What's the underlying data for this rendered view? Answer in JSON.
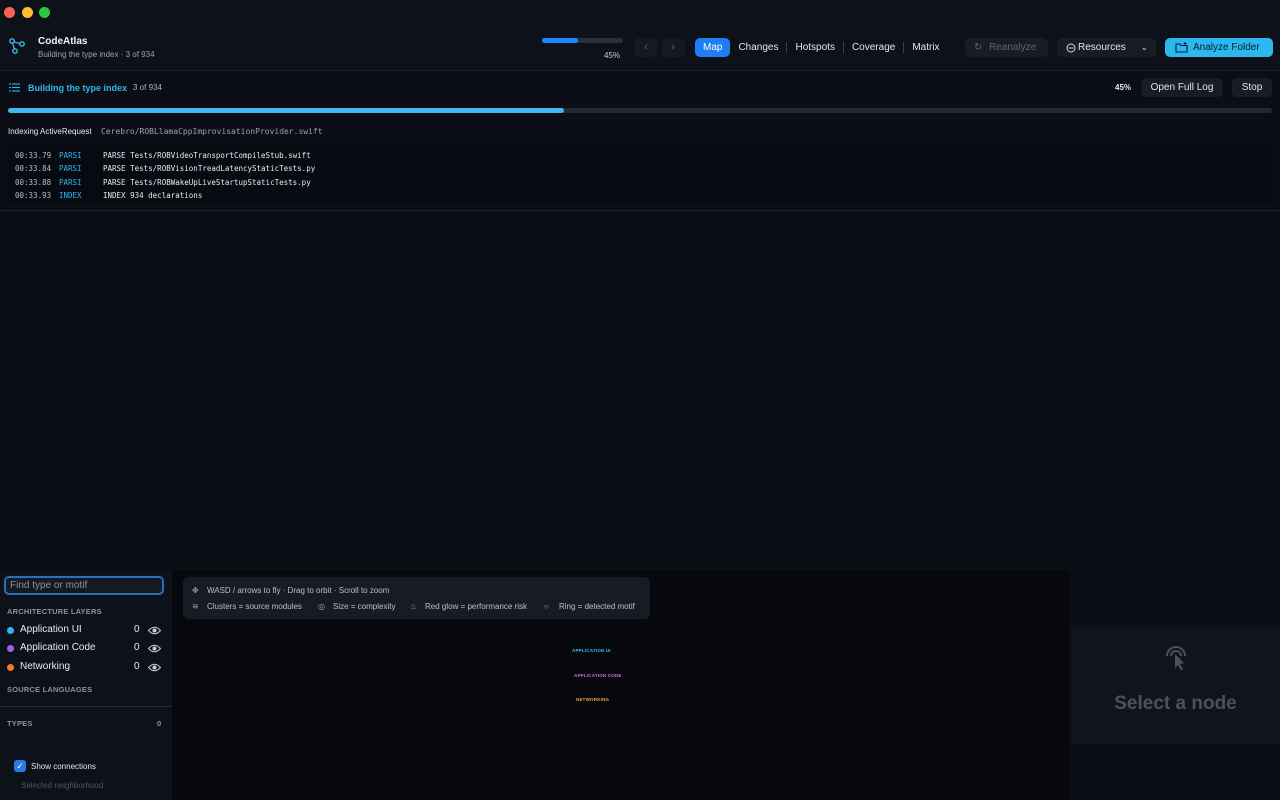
{
  "window": {
    "controls": {
      "close_color": "#ff5f57",
      "minimize_color": "#febc2e",
      "zoom_color": "#28c840"
    }
  },
  "header": {
    "app_title": "CodeAtlas",
    "subtitle": "Building the type index · 3 of 934",
    "progress": {
      "percent_label": "45%",
      "fraction": 0.45
    },
    "tabs": [
      {
        "label": "Map",
        "active": true
      },
      {
        "label": "Changes",
        "active": false
      },
      {
        "label": "Hotspots",
        "active": false
      },
      {
        "label": "Coverage",
        "active": false
      },
      {
        "label": "Matrix",
        "active": false
      }
    ],
    "reanalyze_label": "Reanalyze",
    "resources_label": "Resources",
    "analyze_label": "Analyze Folder",
    "accent_color": "#2cb7ee"
  },
  "status": {
    "title": "Building the type index",
    "count": "3 of 934",
    "percent_label": "45%",
    "fraction": 0.44,
    "open_log_label": "Open Full Log",
    "stop_label": "Stop",
    "indexing_label": "Indexing ActiveRequest",
    "indexing_path": "Cerebro/ROBLlamaCppImprovisationProvider.swift"
  },
  "log": [
    {
      "time": "00:33.79",
      "kind": "PARSI",
      "message": "PARSE Tests/ROBVideoTransportCompileStub.swift"
    },
    {
      "time": "00:33.84",
      "kind": "PARSI",
      "message": "PARSE Tests/ROBVisionTreadLatencyStaticTests.py"
    },
    {
      "time": "00:33.88",
      "kind": "PARSI",
      "message": "PARSE Tests/ROBWakeUpLiveStartupStaticTests.py"
    },
    {
      "time": "00:33.93",
      "kind": "INDEX",
      "message": "INDEX 934 declarations"
    }
  ],
  "sidebar": {
    "search_placeholder": "Find type or motif",
    "architecture_title": "ARCHITECTURE LAYERS",
    "layers": [
      {
        "name": "Application UI",
        "count": "0",
        "color": "#2fb6ef"
      },
      {
        "name": "Application Code",
        "count": "0",
        "color": "#a45ee8"
      },
      {
        "name": "Networking",
        "count": "0",
        "color": "#ef7d2f"
      }
    ],
    "source_languages_title": "SOURCE LANGUAGES",
    "types_title": "TYPES",
    "types_count": "0",
    "show_connections_label": "Show connections",
    "selected_neighborhood_label": "Selected neighborhood"
  },
  "canvas": {
    "hint_nav": "WASD / arrows to fly · Drag to orbit · Scroll to zoom",
    "hint_clusters": "Clusters = source modules",
    "hint_size": "Size = complexity",
    "hint_glow": "Red glow = performance risk",
    "hint_ring": "Ring = detected motif",
    "node_labels": [
      {
        "text": "APPLICATION UI",
        "color": "#2fc7f2"
      },
      {
        "text": "APPLICATION CODE",
        "color": "#d86ee8"
      },
      {
        "text": "NETWORKING",
        "color": "#f0a52e"
      }
    ]
  },
  "inspector": {
    "empty_title": "Select a node"
  }
}
